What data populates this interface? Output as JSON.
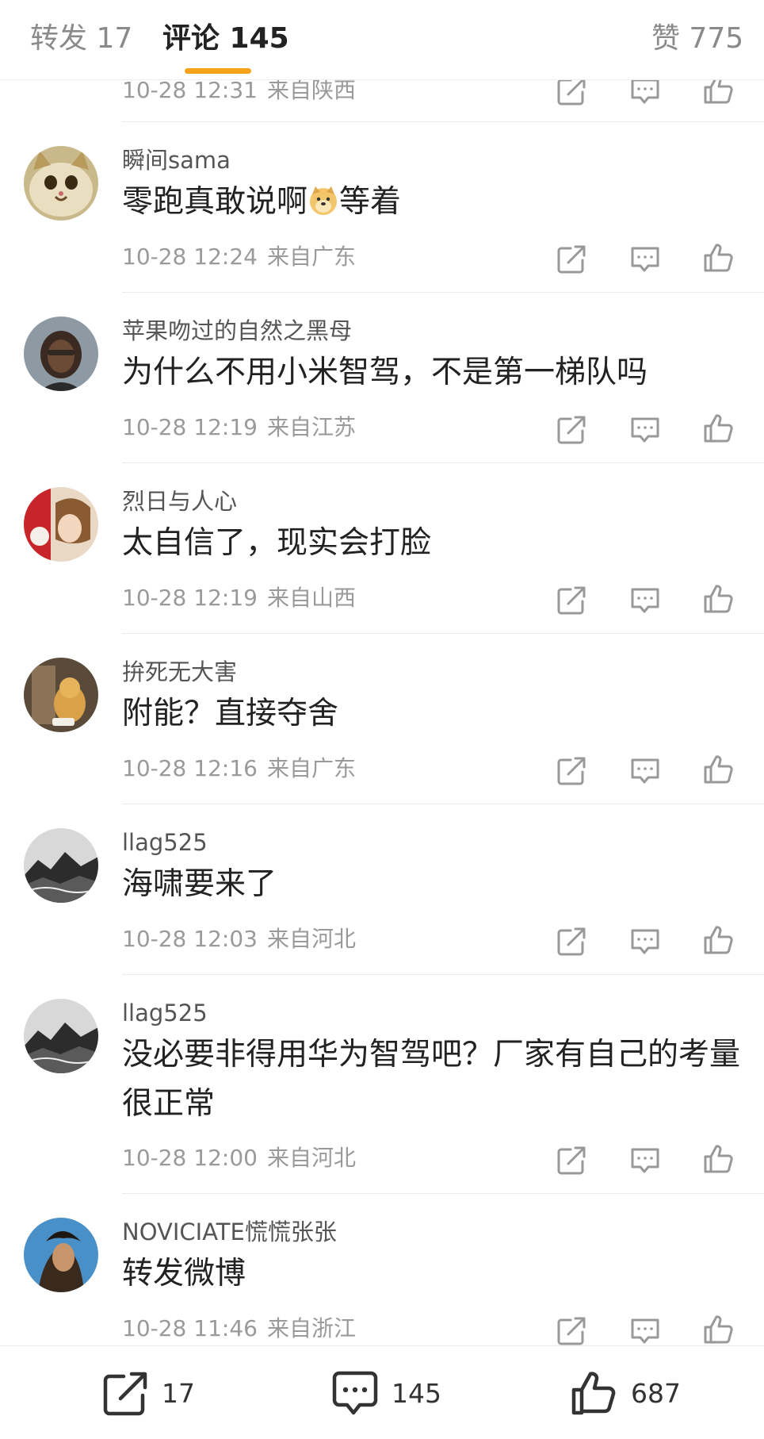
{
  "tabs": {
    "repost": "转发 17",
    "comments": "评论 145",
    "likes": "赞 775"
  },
  "accent_color": "#f7a21b",
  "partial_comment": {
    "time": "10-28 12:31",
    "location": "来自陕西"
  },
  "comments": [
    {
      "username": "瞬间sama",
      "text_before": "零跑真敢说啊",
      "emoji": "doge-emoji",
      "text_after": "等着",
      "time": "10-28 12:24",
      "location": "来自广东"
    },
    {
      "username": "苹果吻过的自然之黑母",
      "text": "为什么不用小米智驾，不是第一梯队吗",
      "time": "10-28 12:19",
      "location": "来自江苏"
    },
    {
      "username": "烈日与人心",
      "text": "太自信了，现实会打脸",
      "time": "10-28 12:19",
      "location": "来自山西"
    },
    {
      "username": "拚死无大害",
      "text": "附能？直接夺舍",
      "time": "10-28 12:16",
      "location": "来自广东"
    },
    {
      "username": "llag525",
      "text": "海啸要来了",
      "time": "10-28 12:03",
      "location": "来自河北"
    },
    {
      "username": "llag525",
      "text": "没必要非得用华为智驾吧？厂家有自己的考量很正常",
      "time": "10-28 12:00",
      "location": "来自河北"
    },
    {
      "username": "NOVICIATE慌慌张张",
      "text": "转发微博",
      "time": "10-28 11:46",
      "location": "来自浙江"
    }
  ],
  "bottom_bar": {
    "reposts": "17",
    "comments": "145",
    "likes": "687"
  },
  "icons": [
    "share-icon",
    "comment-icon",
    "like-icon",
    "doge-emoji"
  ]
}
